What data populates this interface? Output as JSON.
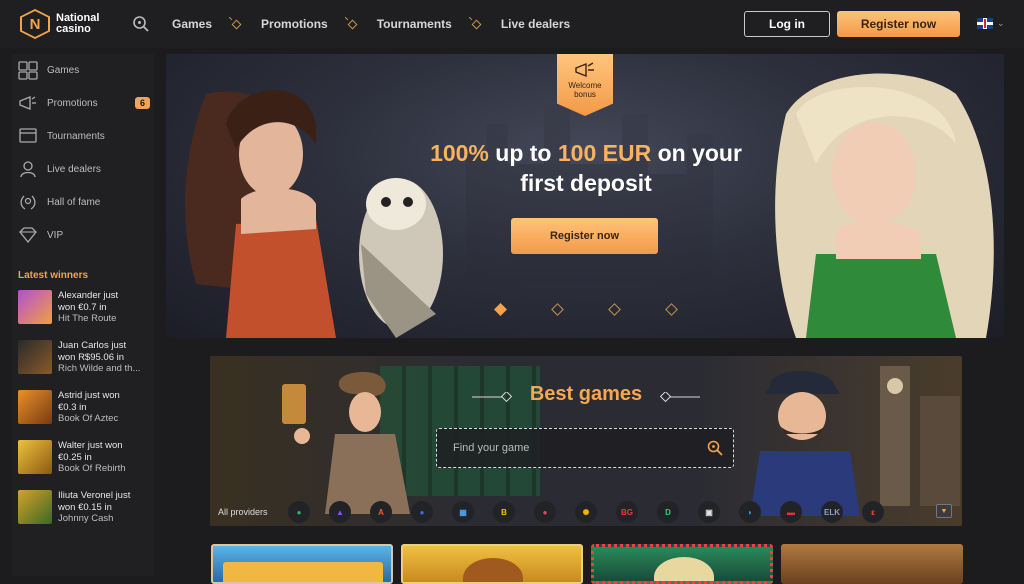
{
  "header": {
    "logo_line1": "National",
    "logo_line2": "casino",
    "logo_letter": "N",
    "nav": [
      "Games",
      "Promotions",
      "Tournaments",
      "Live dealers"
    ],
    "login_label": "Log in",
    "register_label": "Register now",
    "language_icon": "uk-flag-icon"
  },
  "sidebar": {
    "items": [
      {
        "label": "Games",
        "icon": "games-icon"
      },
      {
        "label": "Promotions",
        "icon": "megaphone-icon",
        "badge": "6"
      },
      {
        "label": "Tournaments",
        "icon": "tournaments-icon"
      },
      {
        "label": "Live dealers",
        "icon": "dealer-icon"
      },
      {
        "label": "Hall of fame",
        "icon": "laurel-icon"
      },
      {
        "label": "VIP",
        "icon": "diamond-icon"
      }
    ],
    "winners_title": "Latest winners",
    "winners": [
      {
        "line1": "Alexander just",
        "line2": "won €0.7 in",
        "game": "Hit The Route"
      },
      {
        "line1": "Juan Carlos just",
        "line2": "won R$95.06 in",
        "game": "Rich Wilde and th..."
      },
      {
        "line1": "Astrid just won",
        "line2": "€0.3 in",
        "game": "Book Of Aztec"
      },
      {
        "line1": "Walter just won",
        "line2": "€0.25 in",
        "game": "Book Of Rebirth"
      },
      {
        "line1": "Iliuta Veronel just",
        "line2": "won €0.15 in",
        "game": "Johnny Cash"
      }
    ]
  },
  "hero": {
    "badge_line1": "Welcome",
    "badge_line2": "bonus",
    "headline_accent1": "100%",
    "headline_mid": " up to ",
    "headline_accent2": "100 EUR",
    "headline_end": " on your",
    "headline_line2": "first deposit",
    "cta_label": "Register now",
    "slides_count": 4,
    "active_slide": 1
  },
  "games_section": {
    "title": "Best games",
    "search_placeholder": "Find your game",
    "providers_label": "All providers",
    "providers": [
      {
        "text": "●",
        "color": "#2db36a"
      },
      {
        "text": "▲",
        "color": "#8d4bf0"
      },
      {
        "text": "A",
        "color": "#f05a3a"
      },
      {
        "text": "●",
        "color": "#3a6ee8"
      },
      {
        "text": "▦",
        "color": "#4aa3f0"
      },
      {
        "text": "B",
        "color": "#f5c400"
      },
      {
        "text": "●",
        "color": "#e04a5a"
      },
      {
        "text": "✺",
        "color": "#f5b400"
      },
      {
        "text": "BG",
        "color": "#e83a3a"
      },
      {
        "text": "D",
        "color": "#2fcf7a"
      },
      {
        "text": "▣",
        "color": "#e0e0e0"
      },
      {
        "text": "◗",
        "color": "#3aa6f0"
      },
      {
        "text": "▬",
        "color": "#e8303a"
      },
      {
        "text": "ELK",
        "color": "#8aa0c8"
      },
      {
        "text": "ε",
        "color": "#f05a2a"
      }
    ]
  },
  "colors": {
    "accent": "#f6a24a",
    "background": "#1c1c1e"
  }
}
